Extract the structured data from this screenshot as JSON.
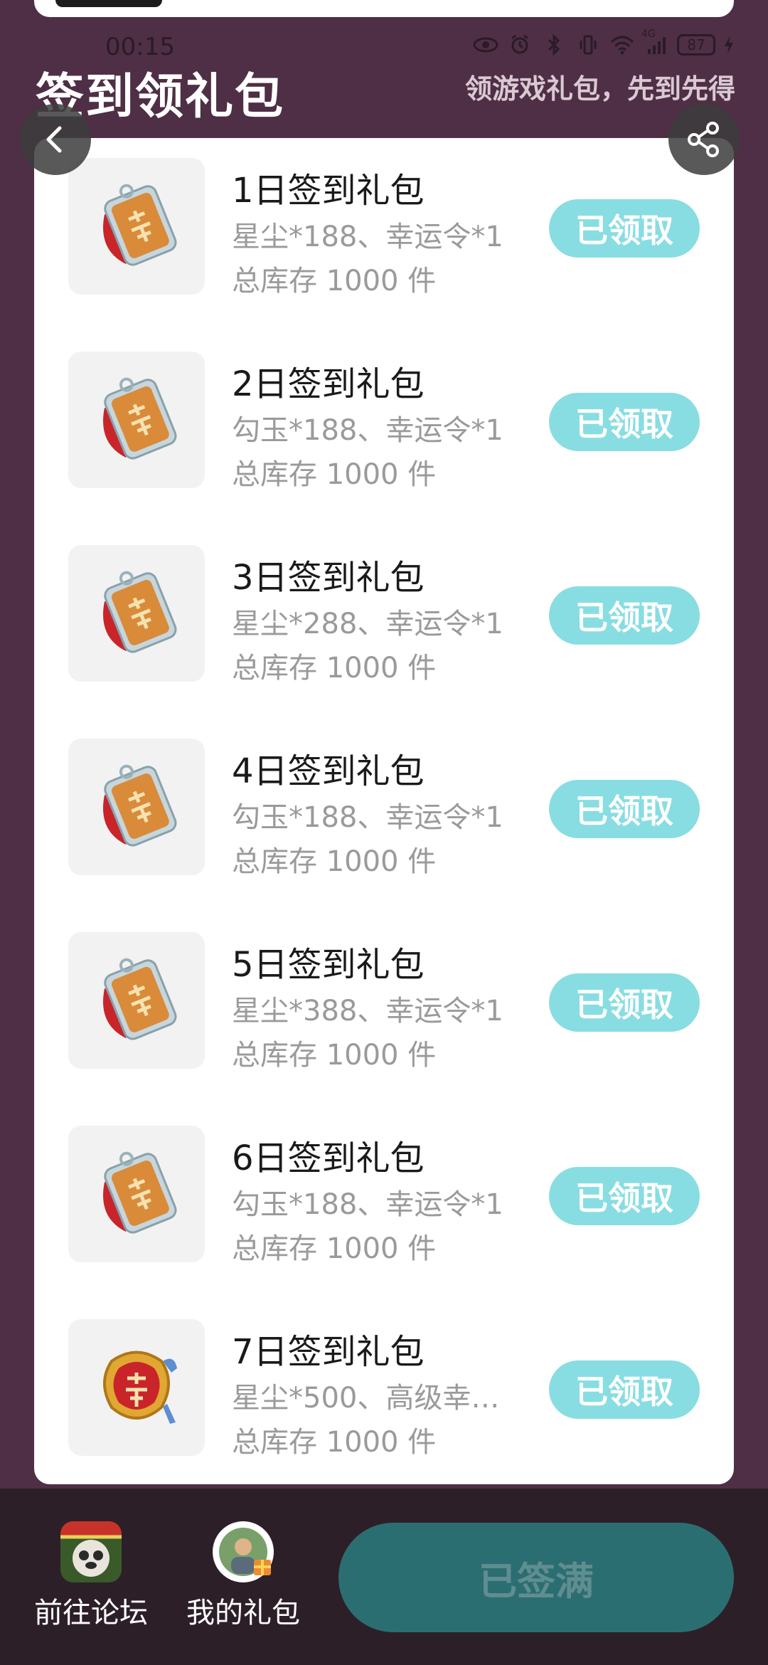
{
  "status": {
    "time": "00:15",
    "battery": "87",
    "network": "4G"
  },
  "header": {
    "title": "签到领礼包",
    "subtitle": "领游戏礼包，先到先得"
  },
  "gifts": [
    {
      "title": "1日签到礼包",
      "desc": "星尘*188、幸运令*1",
      "stock": "总库存 1000 件",
      "button": "已领取",
      "icon": "lucky-token-icon"
    },
    {
      "title": "2日签到礼包",
      "desc": "勾玉*188、幸运令*1",
      "stock": "总库存 1000 件",
      "button": "已领取",
      "icon": "lucky-token-icon"
    },
    {
      "title": "3日签到礼包",
      "desc": "星尘*288、幸运令*1",
      "stock": "总库存 1000 件",
      "button": "已领取",
      "icon": "lucky-token-icon"
    },
    {
      "title": "4日签到礼包",
      "desc": "勾玉*188、幸运令*1",
      "stock": "总库存 1000 件",
      "button": "已领取",
      "icon": "lucky-token-icon"
    },
    {
      "title": "5日签到礼包",
      "desc": "星尘*388、幸运令*1",
      "stock": "总库存 1000 件",
      "button": "已领取",
      "icon": "lucky-token-icon"
    },
    {
      "title": "6日签到礼包",
      "desc": "勾玉*188、幸运令*1",
      "stock": "总库存 1000 件",
      "button": "已领取",
      "icon": "lucky-token-icon"
    },
    {
      "title": "7日签到礼包",
      "desc": "星尘*500、高级幸…",
      "stock": "总库存 1000 件",
      "button": "已领取",
      "icon": "premium-lucky-token-icon"
    }
  ],
  "bottom": {
    "forum_label": "前往论坛",
    "my_gifts_label": "我的礼包",
    "signed_label": "已签满"
  },
  "colors": {
    "background": "#4f2f45",
    "claimed_button": "#88dde2",
    "signed_button": "#2b6e72"
  }
}
